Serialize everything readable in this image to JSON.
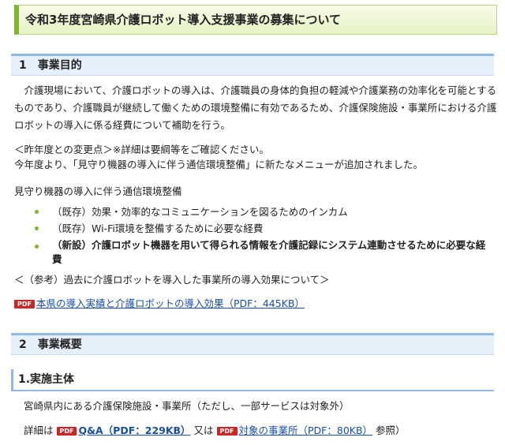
{
  "title": "令和3年度宮崎県介護ロボット導入支援事業の募集について",
  "section1": {
    "num": "1",
    "title": "事業目的",
    "purpose": "介護現場において、介護ロボットの導入は、介護職員の身体的負担の軽減や介護業務の効率化を可能とするものであり、介護職員が継続して働くための環境整備に有効であるため、介護保険施設・事業所における介護ロボットの導入に係る経費について補助を行う。",
    "changes_heading": "＜昨年度との変更点＞※詳細は要綱等をご確認ください。",
    "changes_text": "今年度より、「見守り機器の導入に伴う通信環境整備」に新たなメニューが追加されました。",
    "list_heading": "見守り機器の導入に伴う通信環境整備",
    "bullets": [
      "（既存）効果・効率的なコミュニケーションを図るためのインカム",
      "（既存）Wi-Fi環境を整備するために必要な経費",
      "（新設）介護ロボット機器を用いて得られる情報を介護記録にシステム連動させるために必要な経費"
    ],
    "reference": "＜（参考）過去に介護ロボットを導入した事業所の導入効果について＞",
    "pdf_badge": "PDF",
    "pdf_link": "本県の導入実績と介護ロボットの導入効果（PDF：445KB）"
  },
  "section2": {
    "num": "2",
    "title": "事業概要",
    "sub_title": "1.実施主体",
    "entity": "宮崎県内にある介護保険施設・事業所（ただし、一部サービスは対象外）",
    "details_prefix": "詳細は",
    "pdf_badge": "PDF",
    "link_qa": "Q&A（PDF：229KB）",
    "middle": "又は",
    "link_target": "対象の事業所（PDF：80KB）",
    "suffix": "参照）"
  },
  "colors": {
    "accent_green": "#7fb430",
    "heading_blue": "#8fb8e6",
    "pdf_red": "#c62828",
    "link_blue": "#1a4fa0"
  }
}
